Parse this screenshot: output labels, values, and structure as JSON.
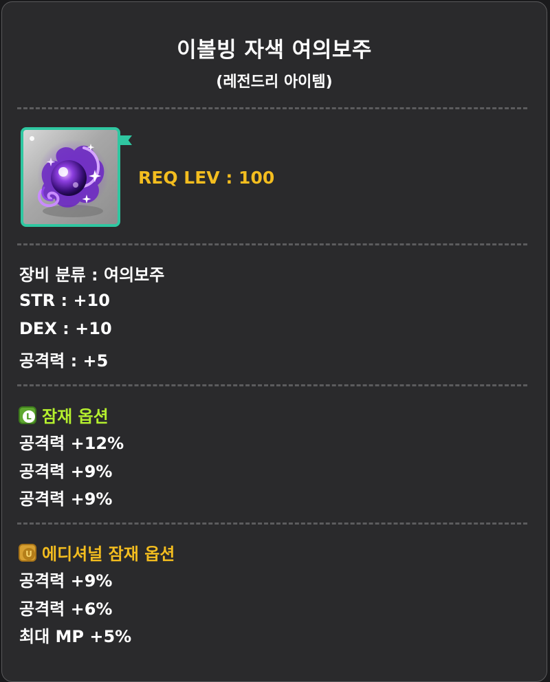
{
  "item": {
    "name": "이볼빙 자색 여의보주",
    "grade": "(레전드리 아이템)",
    "req_lev": "REQ LEV : 100",
    "icon": "purple-orb-icon"
  },
  "stats": [
    "장비 분류 : 여의보주",
    "STR : +10",
    "DEX : +10",
    "공격력 : +5"
  ],
  "potential": {
    "title": "잠재 옵션",
    "badge": "L",
    "color": "#b5f02e",
    "lines": [
      "공격력 +12%",
      "공격력 +9%",
      "공격력 +9%"
    ]
  },
  "additional_potential": {
    "title": "에디셔널 잠재 옵션",
    "badge": "U",
    "color": "#f3bd1f",
    "lines": [
      "공격력 +9%",
      "공격력 +6%",
      "최대 MP +5%"
    ]
  },
  "colors": {
    "panel": "#2a2a2c",
    "frame": "#2fc7a1",
    "req_lev": "#f3bd1f"
  }
}
